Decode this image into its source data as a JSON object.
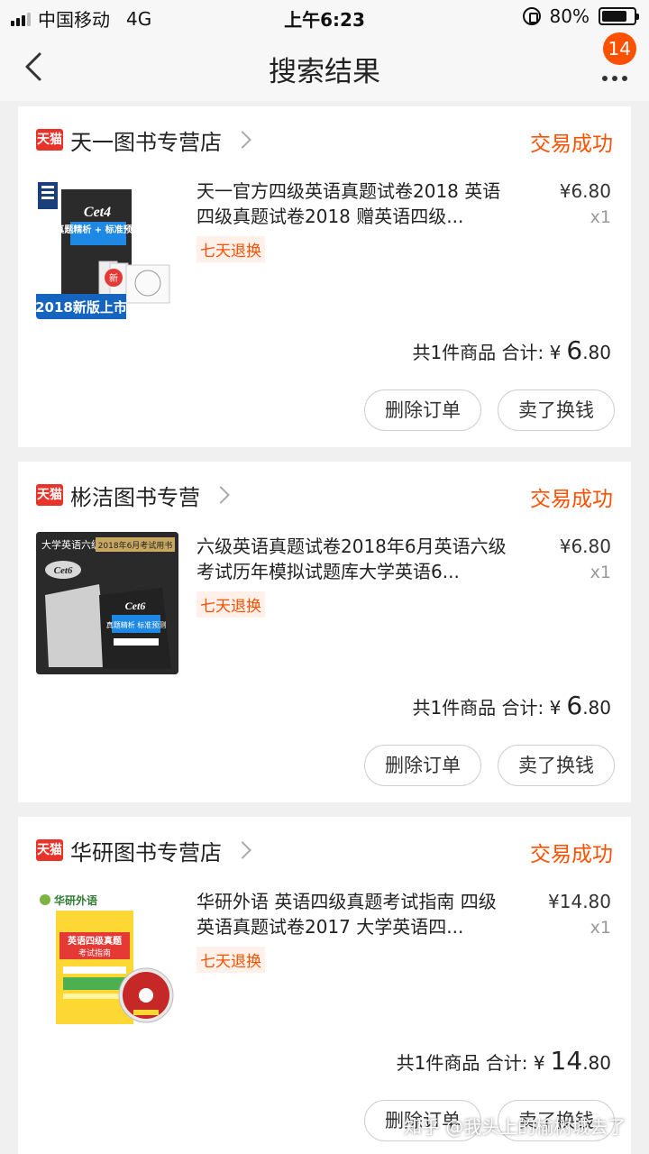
{
  "status_bar": {
    "carrier": "中国移动",
    "network": "4G",
    "time": "上午6:23",
    "battery": "80%",
    "battery_level": 0.8
  },
  "nav": {
    "title": "搜索结果",
    "badge_count": "14"
  },
  "orders": [
    {
      "shop_logo_text": "天猫",
      "shop": "天一图书专营店",
      "status": "交易成功",
      "title": "天一官方四级英语真题试卷2018 英语四级真题试卷2018 赠英语四级...",
      "tag": "七天退换",
      "price": "¥6.80",
      "qty": "x1",
      "summary_label": "共1件商品 合计: ¥",
      "total_int": "6",
      "total_dec": ".80",
      "delete_label": "删除订单",
      "sell_label": "卖了换钱"
    },
    {
      "shop_logo_text": "天猫",
      "shop": "彬洁图书专营",
      "status": "交易成功",
      "title": "六级英语真题试卷2018年6月英语六级考试历年模拟试题库大学英语6...",
      "tag": "七天退换",
      "price": "¥6.80",
      "qty": "x1",
      "summary_label": "共1件商品 合计: ¥",
      "total_int": "6",
      "total_dec": ".80",
      "delete_label": "删除订单",
      "sell_label": "卖了换钱"
    },
    {
      "shop_logo_text": "天猫",
      "shop": "华研图书专营店",
      "status": "交易成功",
      "title": "华研外语 英语四级真题考试指南 四级英语真题试卷2017 大学英语四...",
      "tag": "七天退换",
      "price": "¥14.80",
      "qty": "x1",
      "summary_label": "共1件商品 合计: ¥",
      "total_int": "14",
      "total_dec": ".80",
      "delete_label": "删除订单",
      "sell_label": "卖了换钱"
    }
  ],
  "thumbnails": {
    "book1_cover": "Cet4",
    "book1_subtitle": "真题精析 + 标准预测",
    "book1_banner": "2018新版上市",
    "book2_header": "大学英语六级",
    "book2_ribbon": "2018年6月考试用书",
    "book2_cover": "Cet6",
    "book2_subtitle": "真题精析 标准预测",
    "book3_brand": "华研外语",
    "book3_title": "英语四级真题",
    "book3_subtitle": "考试指南"
  },
  "watermark": "知乎 @我头上的榆树城去了",
  "colors": {
    "accent": "#ff5000",
    "tmall_red": "#e8332a"
  }
}
